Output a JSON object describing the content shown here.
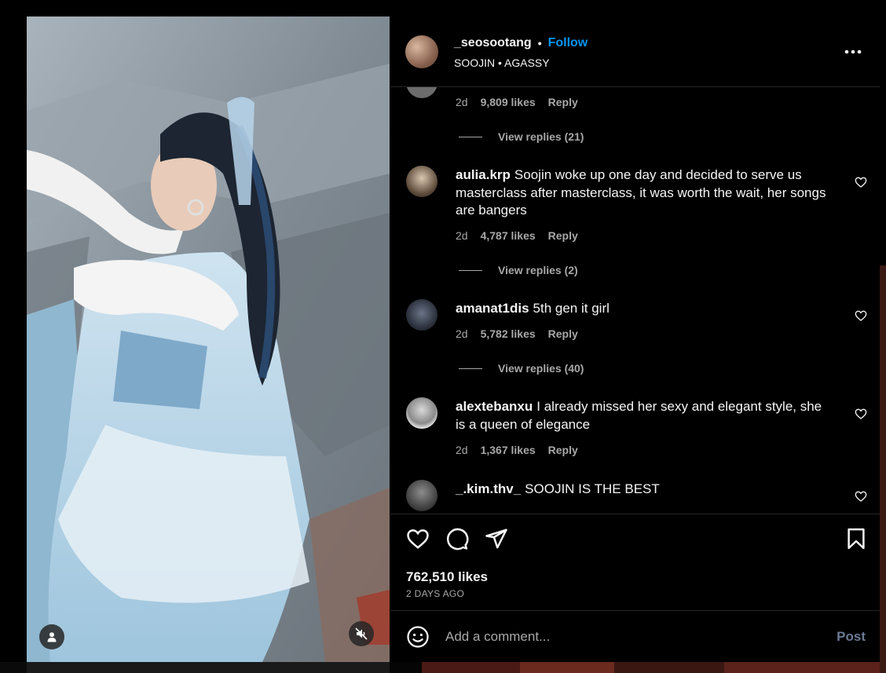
{
  "header": {
    "username": "_seosootang",
    "separator": "•",
    "follow_label": "Follow",
    "audio": "SOOJIN • AGASSY",
    "more_icon": "more-horizontal-icon"
  },
  "comments": [
    {
      "username": "",
      "text": "",
      "age": "2d",
      "likes": "9,809 likes",
      "reply_label": "Reply",
      "view_replies": "View replies (21)"
    },
    {
      "username": "aulia.krp",
      "text": "Soojin woke up one day and decided to serve us masterclass after masterclass, it was worth the wait, her songs are bangers",
      "age": "2d",
      "likes": "4,787 likes",
      "reply_label": "Reply",
      "view_replies": "View replies (2)"
    },
    {
      "username": "amanat1dis",
      "text": "5th gen it girl",
      "age": "2d",
      "likes": "5,782 likes",
      "reply_label": "Reply",
      "view_replies": "View replies (40)"
    },
    {
      "username": "alextebanxu",
      "text": "I already missed her sexy and elegant style, she is a queen of elegance",
      "age": "2d",
      "likes": "1,367 likes",
      "reply_label": "Reply",
      "view_replies": ""
    },
    {
      "username": "_.kim.thv_",
      "text": "SOOJIN IS THE BEST",
      "age": "",
      "likes": "",
      "reply_label": "",
      "view_replies": ""
    }
  ],
  "actions": {
    "likes": "762,510 likes",
    "date": "2 DAYS AGO"
  },
  "composer": {
    "placeholder": "Add a comment...",
    "post_label": "Post"
  },
  "colors": {
    "accent": "#0095f6",
    "muted_text": "#a8a8a8",
    "divider": "#262626",
    "post_disabled": "#6b7a94"
  }
}
